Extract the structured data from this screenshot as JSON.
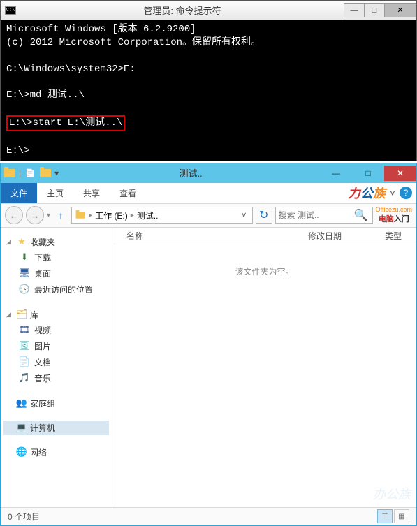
{
  "cmd": {
    "title": "管理员: 命令提示符",
    "lines": {
      "l1": "Microsoft Windows [版本 6.2.9200]",
      "l2": "(c) 2012 Microsoft Corporation。保留所有权利。",
      "l3": "C:\\Windows\\system32>E:",
      "l4": "E:\\>md 测试..\\",
      "l5": "E:\\>start E:\\测试..\\",
      "l6": "E:\\>"
    },
    "controls": {
      "min": "—",
      "max": "□",
      "close": "✕"
    }
  },
  "explorer": {
    "title": "测试..",
    "qat_dropdown": "▾",
    "wcontrols": {
      "min": "—",
      "max": "□",
      "close": "✕"
    },
    "tabs": {
      "file": "文件",
      "home": "主页",
      "share": "共享",
      "view": "查看"
    },
    "ribbon_right": {
      "chev": "˅",
      "help": "?"
    },
    "brand": {
      "p1": "力",
      "p2": "公",
      "p3": "族",
      "sub": "Officezu.com"
    },
    "brand2": {
      "p1": "电脑",
      "p2": "入门"
    },
    "nav": {
      "back": "←",
      "fwd": "→",
      "history": "▾",
      "up": "↑",
      "refresh": "↻",
      "addr_drop": "˅"
    },
    "address": {
      "drive": "工作 (E:)",
      "folder": "测试..",
      "sep": "▸"
    },
    "search": {
      "placeholder": "搜索 测试..",
      "icon": "🔍"
    },
    "sidebar": {
      "favorites": {
        "label": "收藏夹",
        "items": [
          "下载",
          "桌面",
          "最近访问的位置"
        ]
      },
      "libraries": {
        "label": "库",
        "items": [
          "视频",
          "图片",
          "文档",
          "音乐"
        ]
      },
      "homegroup": {
        "label": "家庭组"
      },
      "computer": {
        "label": "计算机"
      },
      "network": {
        "label": "网络"
      },
      "tri_open": "◢",
      "tri_closed": "▷"
    },
    "columns": {
      "name": "名称",
      "date": "修改日期",
      "type": "类型"
    },
    "empty": "该文件夹为空。",
    "status": "0 个项目",
    "watermark": "办公族"
  }
}
